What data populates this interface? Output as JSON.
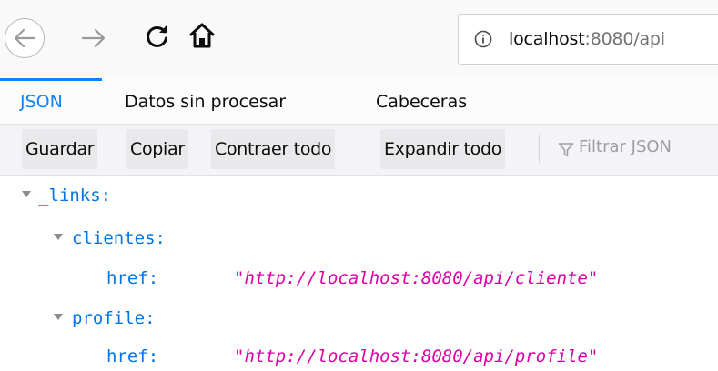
{
  "nav": {
    "url_host": "localhost",
    "url_rest": ":8080/api"
  },
  "tabs": [
    {
      "label": "JSON"
    },
    {
      "label": "Datos sin procesar"
    },
    {
      "label": "Cabeceras"
    }
  ],
  "toolbar": {
    "save_label": "Guardar",
    "copy_label": "Copiar",
    "collapse_label": "Contraer todo",
    "expand_label": "Expandir todo",
    "filter_placeholder": "Filtrar JSON"
  },
  "tree": {
    "root_key": "_links:",
    "clientes_key": "clientes:",
    "clientes_href_key": "href:",
    "clientes_href_value": "\"http://localhost:8080/api/cliente\"",
    "profile_key": "profile:",
    "profile_href_key": "href:",
    "profile_href_value": "\"http://localhost:8080/api/profile\""
  },
  "colors": {
    "accent": "#0a84ff",
    "json_key": "#0074e8",
    "json_string": "#dd00a9"
  },
  "icons": [
    "back-arrow-icon",
    "forward-arrow-icon",
    "reload-icon",
    "home-icon",
    "info-icon",
    "filter-icon",
    "expand-triangle-icon"
  ]
}
